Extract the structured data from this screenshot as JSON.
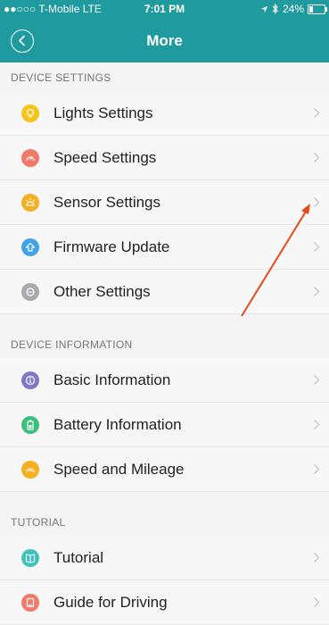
{
  "status_bar": {
    "signal_dots": "●●○○○",
    "carrier": "T-Mobile",
    "network": "LTE",
    "time": "7:01 PM",
    "battery": "24%",
    "battery_level_percent": 24
  },
  "header": {
    "title": "More"
  },
  "sections": [
    {
      "title": "DEVICE SETTINGS",
      "items": [
        {
          "label": "Lights Settings",
          "color": "#f5c419",
          "icon": "bulb-icon"
        },
        {
          "label": "Speed Settings",
          "color": "#f0796a",
          "icon": "speedometer-icon"
        },
        {
          "label": "Sensor Settings",
          "color": "#f5b021",
          "icon": "sensor-icon"
        },
        {
          "label": "Firmware Update",
          "color": "#41a3e6",
          "icon": "upload-icon"
        },
        {
          "label": "Other Settings",
          "color": "#a9a9ae",
          "icon": "more-icon"
        }
      ]
    },
    {
      "title": "DEVICE INFORMATION",
      "items": [
        {
          "label": "Basic Information",
          "color": "#7f79c7",
          "icon": "info-icon"
        },
        {
          "label": "Battery Information",
          "color": "#3dbf7c",
          "icon": "battery-icon"
        },
        {
          "label": "Speed and Mileage",
          "color": "#f5b021",
          "icon": "gauge-icon"
        }
      ]
    },
    {
      "title": "TUTORIAL",
      "items": [
        {
          "label": "Tutorial",
          "color": "#3fc1c0",
          "icon": "book-icon"
        },
        {
          "label": "Guide for Driving",
          "color": "#f0796a",
          "icon": "guide-icon"
        }
      ]
    }
  ],
  "annotation_arrow_color": "#e64a19"
}
